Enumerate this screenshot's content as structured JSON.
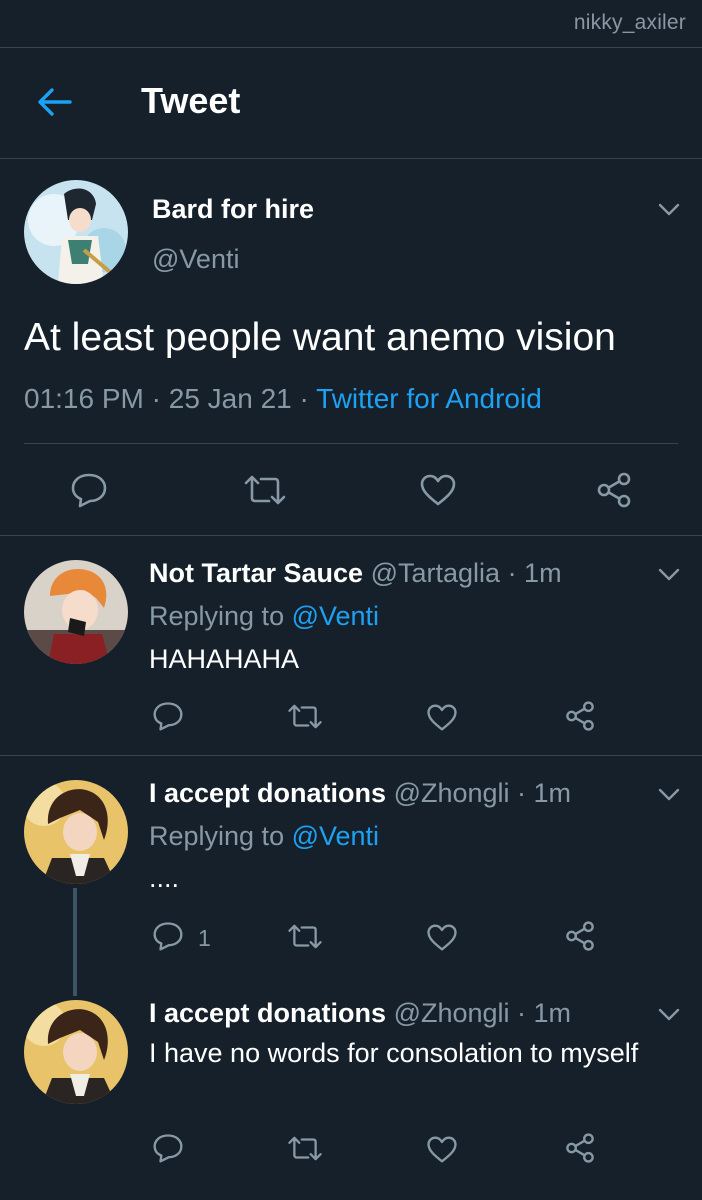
{
  "watermark": "nikky_axiler",
  "header": {
    "title": "Tweet",
    "back_icon": "arrow-left-icon"
  },
  "colors": {
    "background": "#15202b",
    "accent": "#1da1f2",
    "secondary_text": "#8899a6",
    "divider": "#38444d"
  },
  "main_tweet": {
    "name": "Bard for hire",
    "handle": "@Venti",
    "text": "At least people want anemo vision",
    "time": "01:16 PM",
    "sep1": " · ",
    "date": "25 Jan 21",
    "sep2": " · ",
    "source": "Twitter for Android"
  },
  "replies": [
    {
      "name": "Not Tartar Sauce",
      "handle": "@Tartaglia",
      "time": "· 1m",
      "replying_prefix": "Replying to ",
      "replying_to": "@Venti",
      "text": "HAHAHAHA"
    },
    {
      "name": "I accept donations",
      "handle": "@Zhongli",
      "time": "· 1m",
      "replying_prefix": "Replying to ",
      "replying_to": "@Venti",
      "text": "....",
      "reply_count": "1"
    },
    {
      "name": "I accept donations",
      "handle": "@Zhongli",
      "time": "· 1m",
      "text": "I have no words for consolation to myself"
    }
  ]
}
